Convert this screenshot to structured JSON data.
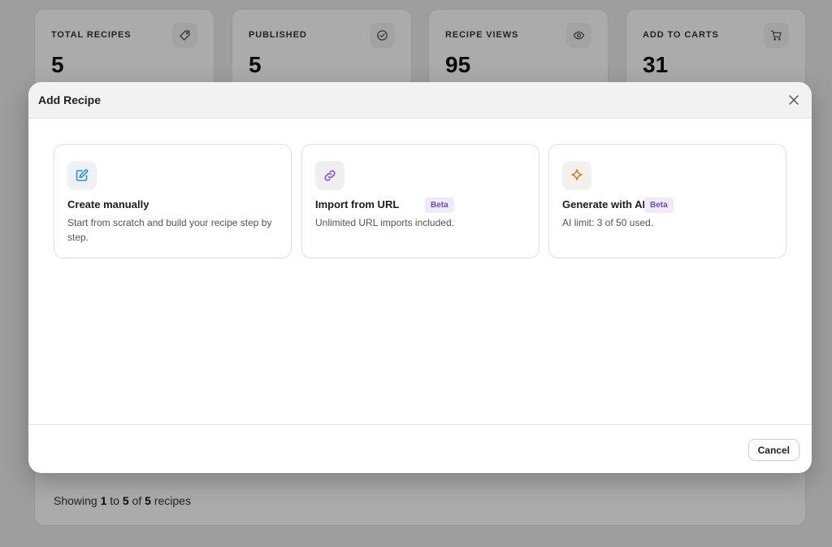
{
  "stats": [
    {
      "label": "TOTAL RECIPES",
      "value": "5",
      "icon": "tag-icon"
    },
    {
      "label": "PUBLISHED",
      "value": "5",
      "icon": "check-circle-icon"
    },
    {
      "label": "RECIPE VIEWS",
      "value": "95",
      "icon": "eye-icon"
    },
    {
      "label": "ADD TO CARTS",
      "value": "31",
      "icon": "cart-icon"
    }
  ],
  "table_footer": {
    "prefix": "Showing",
    "from": "1",
    "to_word": "to",
    "to": "5",
    "of_word": "of",
    "total": "5",
    "suffix": "recipes"
  },
  "modal": {
    "title": "Add Recipe",
    "options": [
      {
        "title": "Create manually",
        "description": "Start from scratch and build your recipe step by step.",
        "icon": "edit-icon",
        "icon_color": "#2f8fd8"
      },
      {
        "title": "Import from URL",
        "description": "Unlimited URL imports included.",
        "badge": "Beta",
        "icon": "link-icon",
        "icon_color": "#8b4fd6"
      },
      {
        "title": "Generate with AI",
        "description": "AI limit: 3 of 50 used.",
        "badge": "Beta",
        "icon": "sparkle-icon",
        "icon_color": "#e07a1f"
      }
    ],
    "cancel_label": "Cancel"
  }
}
